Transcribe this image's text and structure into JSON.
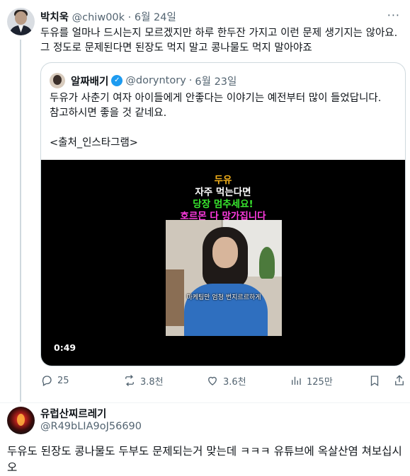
{
  "tweet1": {
    "name": "박치욱",
    "handle": "@chiw00k",
    "sep": "·",
    "date": "6월 24일",
    "text_line1": "두유를 얼마나 드시는지 모르겠지만 하루 한두잔 가지고 이런 문제 생기지는 않아요.",
    "text_line2": "그 정도로 문제된다면 된장도 먹지 말고 콩나물도 먹지 말아야죠",
    "more": "···"
  },
  "quote": {
    "name": "알짜배기",
    "verified": "✓",
    "handle": "@doryntory",
    "sep": "·",
    "date": "6월 23일",
    "text_line1": "두유가 사춘기 여자 아이들에게 안좋다는 이야기는 예전부터 많이 들었답니다.",
    "text_line2": "참고하시면 좋을 것 같네요.",
    "text_line3": "<출처_인스타그램>",
    "video": {
      "caption1": "두유",
      "caption2": "자주 먹는다면",
      "caption3": "당장 멈추세요!",
      "caption4": "호르몬 다 망가집니다",
      "subtitle": "마케팅만 엄청 번지르르하게",
      "duration": "0:49"
    }
  },
  "actions": {
    "replies": "25",
    "retweets": "3.8천",
    "likes": "3.6천",
    "views": "125만"
  },
  "tweet2": {
    "name": "유럽산찌르레기",
    "handle": "@R49bLIA9oJ56690",
    "text": "두유도 된장도 콩나물도 두부도 문제되는거 맞는데 ㅋㅋㅋ 유튜브에 옥살산염 쳐보십시오"
  }
}
